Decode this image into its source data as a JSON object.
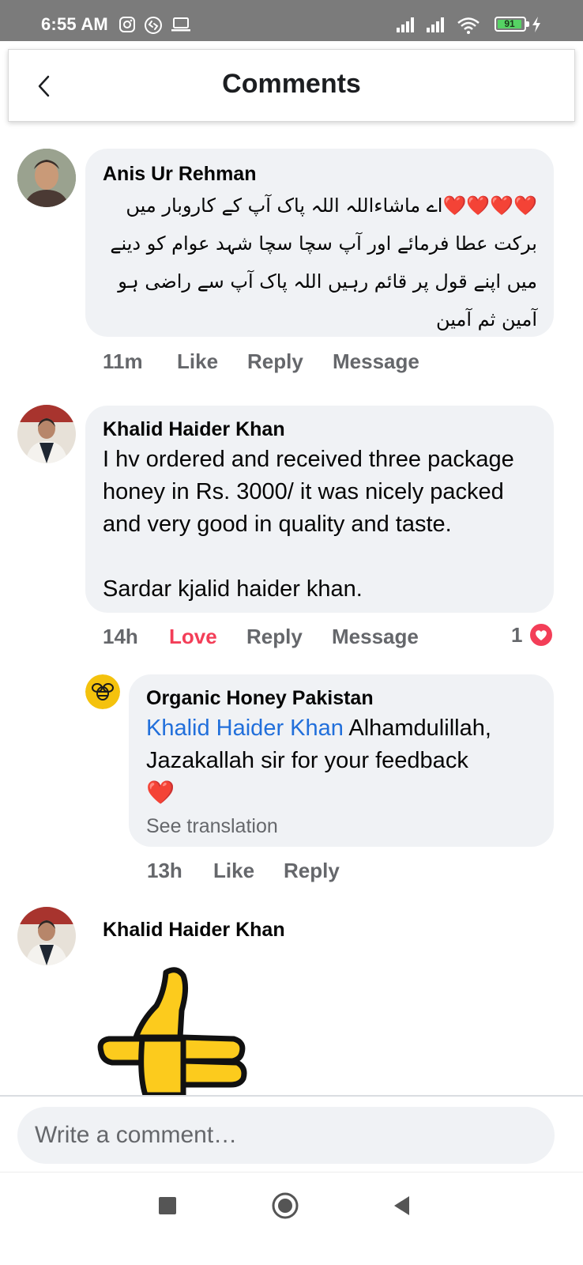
{
  "status_bar": {
    "time": "6:55 AM",
    "battery": "91",
    "icons": [
      "instagram-icon",
      "shazam-icon",
      "laptop-icon",
      "signal-icon",
      "signal-icon",
      "wifi-icon",
      "battery-icon",
      "charging-icon"
    ]
  },
  "header": {
    "title": "Comments",
    "back_icon": "chevron-left-icon"
  },
  "comments": [
    {
      "author": "Anis Ur Rehman",
      "text": "❤️❤️❤️❤️اے ماشاءاللہ اللہ پاک آپ کے کاروبار میں برکت عطا فرمائے اور آپ سچا سچا شہد عوام کو دینے میں اپنے قول پر قائم رہیں اللہ پاک آپ سے راضی ہو آمین ثم آمین",
      "time": "11m",
      "like": "Like",
      "reply": "Reply",
      "message": "Message"
    },
    {
      "author": "Khalid Haider Khan",
      "text": "I hv ordered and received three package honey in Rs. 3000/ it was nicely packed and very good in quality and taste.",
      "text_line2": "Sardar kjalid haider khan.",
      "time": "14h",
      "love": "Love",
      "reply": "Reply",
      "message": "Message",
      "reaction_count": "1",
      "reaction_color": "#f33e58",
      "replies": [
        {
          "author": "Organic Honey Pakistan",
          "mention": "Khalid Haider Khan",
          "text": " Alhamdulillah, Jazakallah sir for your feedback",
          "emoji": "❤️",
          "see_translation": "See translation",
          "time": "13h",
          "like": "Like",
          "reply": "Reply"
        }
      ]
    },
    {
      "author": "Khalid Haider Khan",
      "sticker": "thumbs-up-sticker"
    }
  ],
  "composer": {
    "placeholder": "Write a comment…"
  },
  "nav": {
    "recents_icon": "square-icon",
    "home_icon": "circle-icon",
    "back_icon": "triangle-back-icon"
  },
  "colors": {
    "bubble": "#f0f2f5",
    "love": "#f33e58",
    "mention": "#216fdb",
    "meta": "#65676b",
    "status_bar": "#7b7b7b"
  }
}
